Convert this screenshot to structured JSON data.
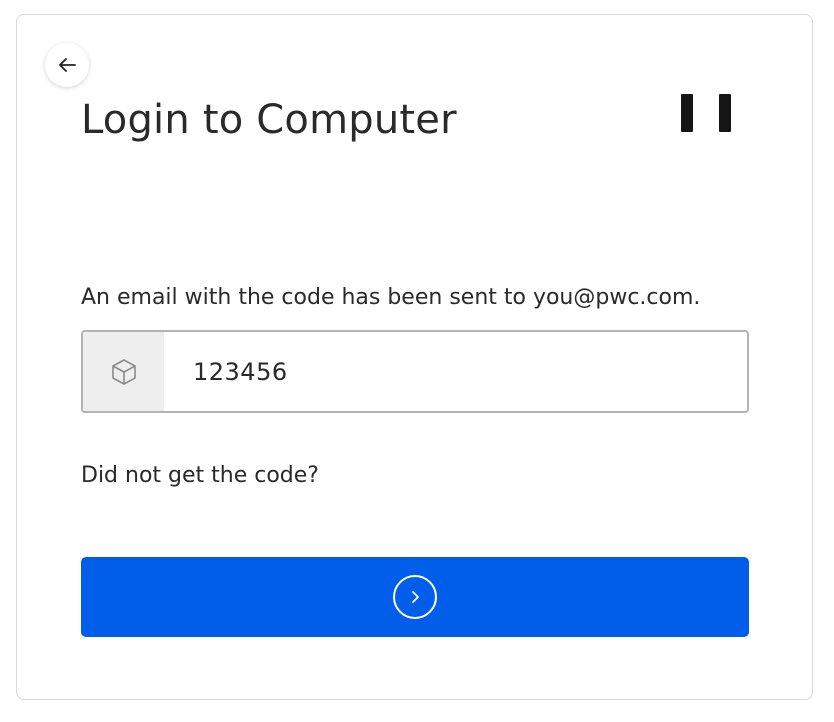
{
  "colors": {
    "accent": "#005eeb",
    "text": "#2a2a2a",
    "field_border": "#b3b3b3",
    "addon_background": "#eeeeee"
  },
  "header": {
    "back_icon": "arrow-left-icon",
    "title": "Login to Computer",
    "logo_icon": "brand-logo"
  },
  "form": {
    "message": "An email with the code has been sent to you@pwc.com.",
    "code_field": {
      "icon": "cube-icon",
      "value": "123456",
      "placeholder": ""
    },
    "resend_link": "Did not get the code?",
    "submit_icon": "chevron-right-circle-icon"
  }
}
